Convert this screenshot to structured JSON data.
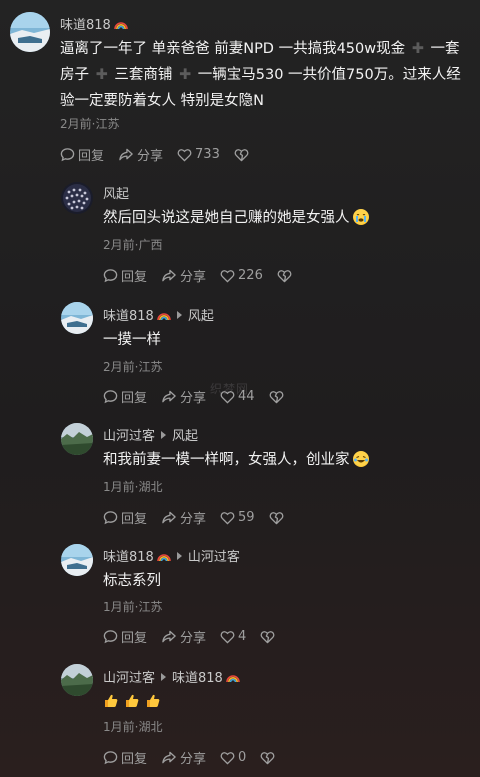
{
  "comments": [
    {
      "id": "c1",
      "user": "味道818",
      "reply_to": "",
      "text_parts": [
        "逼离了一年了 单亲爸爸 前妻NPD 一共搞我450w现金 ",
        " 一套房子 ",
        " 三套商铺 ",
        " 一辆宝马530 一共价值750万。过来人经验一定要防着女人 特别是女隐N"
      ],
      "meta": "2月前·江苏",
      "reply_label": "回复",
      "share_label": "分享",
      "likes": "733"
    },
    {
      "id": "c2",
      "user": "风起",
      "reply_to": "",
      "text": "然后回头说这是她自己赚的她是女强人",
      "meta": "2月前·广西",
      "reply_label": "回复",
      "share_label": "分享",
      "likes": "226"
    },
    {
      "id": "c3",
      "user": "味道818",
      "reply_to": "风起",
      "text": "一摸一样",
      "meta": "2月前·江苏",
      "reply_label": "回复",
      "share_label": "分享",
      "likes": "44"
    },
    {
      "id": "c4",
      "user": "山河过客",
      "reply_to": "风起",
      "text": "和我前妻一模一样啊，女强人，创业家",
      "meta": "1月前·湖北",
      "reply_label": "回复",
      "share_label": "分享",
      "likes": "59"
    },
    {
      "id": "c5",
      "user": "味道818",
      "reply_to": "山河过客",
      "text": "标志系列",
      "meta": "1月前·江苏",
      "reply_label": "回复",
      "share_label": "分享",
      "likes": "4"
    },
    {
      "id": "c6",
      "user": "山河过客",
      "reply_to": "味道818",
      "text": "",
      "meta": "1月前·湖北",
      "reply_label": "回复",
      "share_label": "分享",
      "likes": "0"
    }
  ],
  "watermark": "织梦网",
  "colors": {
    "background": "#1f1c1d",
    "text_primary": "#f2f2f2",
    "text_secondary": "#8a8a8a",
    "username": "#c9c9c9"
  },
  "icons": {
    "reply": "comment-bubble-icon",
    "share": "share-arrow-icon",
    "like": "heart-icon",
    "dislike": "broken-heart-icon",
    "rainbow": "rainbow-emoji",
    "crying": "crying-emoji",
    "laughing": "laughing-crying-emoji",
    "thumbs": "thumbs-up-emoji"
  }
}
